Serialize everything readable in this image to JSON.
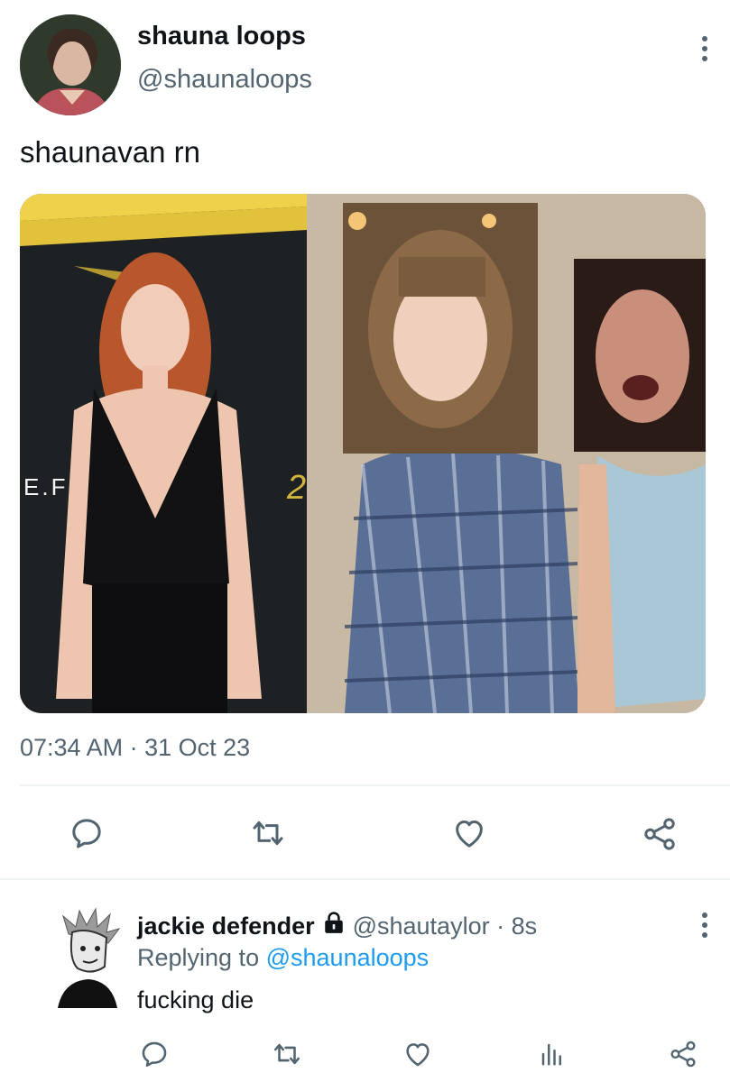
{
  "tweet": {
    "display_name": "shauna loops",
    "handle": "@shaunaloops",
    "text": "shaunavan rn",
    "timestamp": "07:34 AM · 31 Oct 23",
    "media": {
      "poster_text_left": "E.F",
      "poster_text_right": "2"
    },
    "actions": [
      "reply-icon",
      "retweet-icon",
      "like-icon",
      "share-icon"
    ]
  },
  "reply": {
    "display_name": "jackie defender",
    "handle_time": "@shautaylor · 8s",
    "replying_prefix": "Replying to",
    "replying_to": "@shaunaloops",
    "text": "fucking die",
    "actions": [
      "reply-icon",
      "retweet-icon",
      "like-icon",
      "views-icon",
      "share-icon"
    ]
  },
  "colors": {
    "accent": "#1d9bf0",
    "text": "#0f1419",
    "muted": "#536471",
    "divider": "#eff3f4"
  }
}
